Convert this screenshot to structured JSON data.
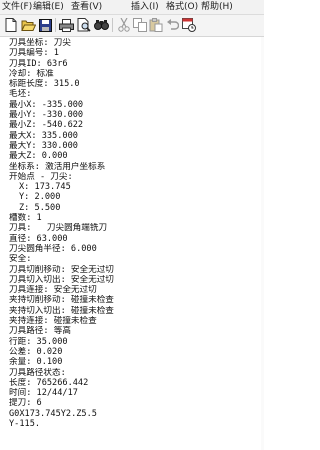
{
  "menubar": {
    "file": "文件(F)",
    "edit": "编辑(E)",
    "view": "查看(V)",
    "insert": "插入(I)",
    "format": "格式(O)",
    "help": "帮助(H)"
  },
  "toolbar": {
    "buttons": [
      "new-file-icon",
      "open-folder-icon",
      "save-icon",
      "print-icon",
      "print-preview-icon",
      "find-icon",
      "cut-icon",
      "copy-icon",
      "paste-icon",
      "undo-icon",
      "insert-datetime-icon"
    ]
  },
  "document": {
    "lines": [
      "刀具坐标: 刀尖",
      "刀具编号: 1",
      "刀具ID: 63r6",
      "冷却: 标准",
      "标距长度: 315.0",
      "毛坯:",
      "最小X: -335.000",
      "最小Y: -330.000",
      "最小Z: -540.622",
      "最大X: 335.000",
      "最大Y: 330.000",
      "最大Z: 0.000",
      "坐标系: 激活用户坐标系",
      "开始点 - 刀尖:",
      "X: 173.745",
      "Y: 2.000",
      "Z: 5.500",
      "槽数: 1",
      "刀具:   刀尖圆角端铣刀",
      "直径: 63.000",
      "刀尖圆角半径: 6.000",
      "安全:",
      "刀具切削移动: 安全无过切",
      "刀具切入切出: 安全无过切",
      "刀具连接: 安全无过切",
      "夹持切削移动: 碰撞未检查",
      "夹持切入切出: 碰撞未检查",
      "夹持连接: 碰撞未检查",
      "刀具路径: 等高",
      "行距: 35.000",
      "公差: 0.020",
      "余量: 0.100",
      "刀具路径状态:",
      "长度: 765266.442",
      "时间: 12/44/17",
      "提刀: 6",
      "G0X173.745Y2.Z5.5",
      "Y-115."
    ]
  }
}
